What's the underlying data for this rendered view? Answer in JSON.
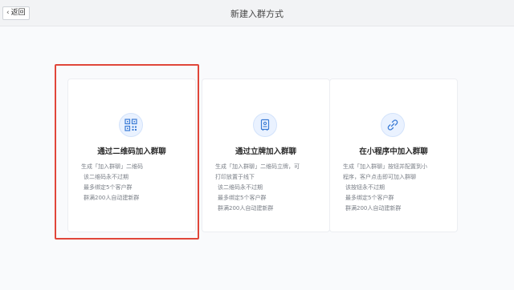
{
  "header": {
    "back_label": "返回",
    "title": "新建入群方式"
  },
  "cards": [
    {
      "icon": "qrcode-icon",
      "title": "通过二维码加入群聊",
      "lines": [
        "生成「加入群聊」二维码",
        "该二维码永不过期",
        "最多绑定5个客户群",
        "群满200人自动建新群"
      ],
      "selected": true
    },
    {
      "icon": "document-icon",
      "title": "通过立牌加入群聊",
      "lines": [
        "生成「加入群聊」二维码立牌，可",
        "打印放置于线下",
        "该二维码永不过期",
        "最多绑定5个客户群",
        "群满200人自动建新群"
      ],
      "selected": false
    },
    {
      "icon": "link-icon",
      "title": "在小程序中加入群聊",
      "lines": [
        "生成「加入群聊」按钮并配置到小",
        "程序，客户点击即可加入群聊",
        "该按钮永不过期",
        "最多绑定5个客户群",
        "群满200人自动建新群"
      ],
      "selected": false
    }
  ],
  "colors": {
    "accent": "#3a7bd5",
    "highlight": "#e0463a"
  }
}
